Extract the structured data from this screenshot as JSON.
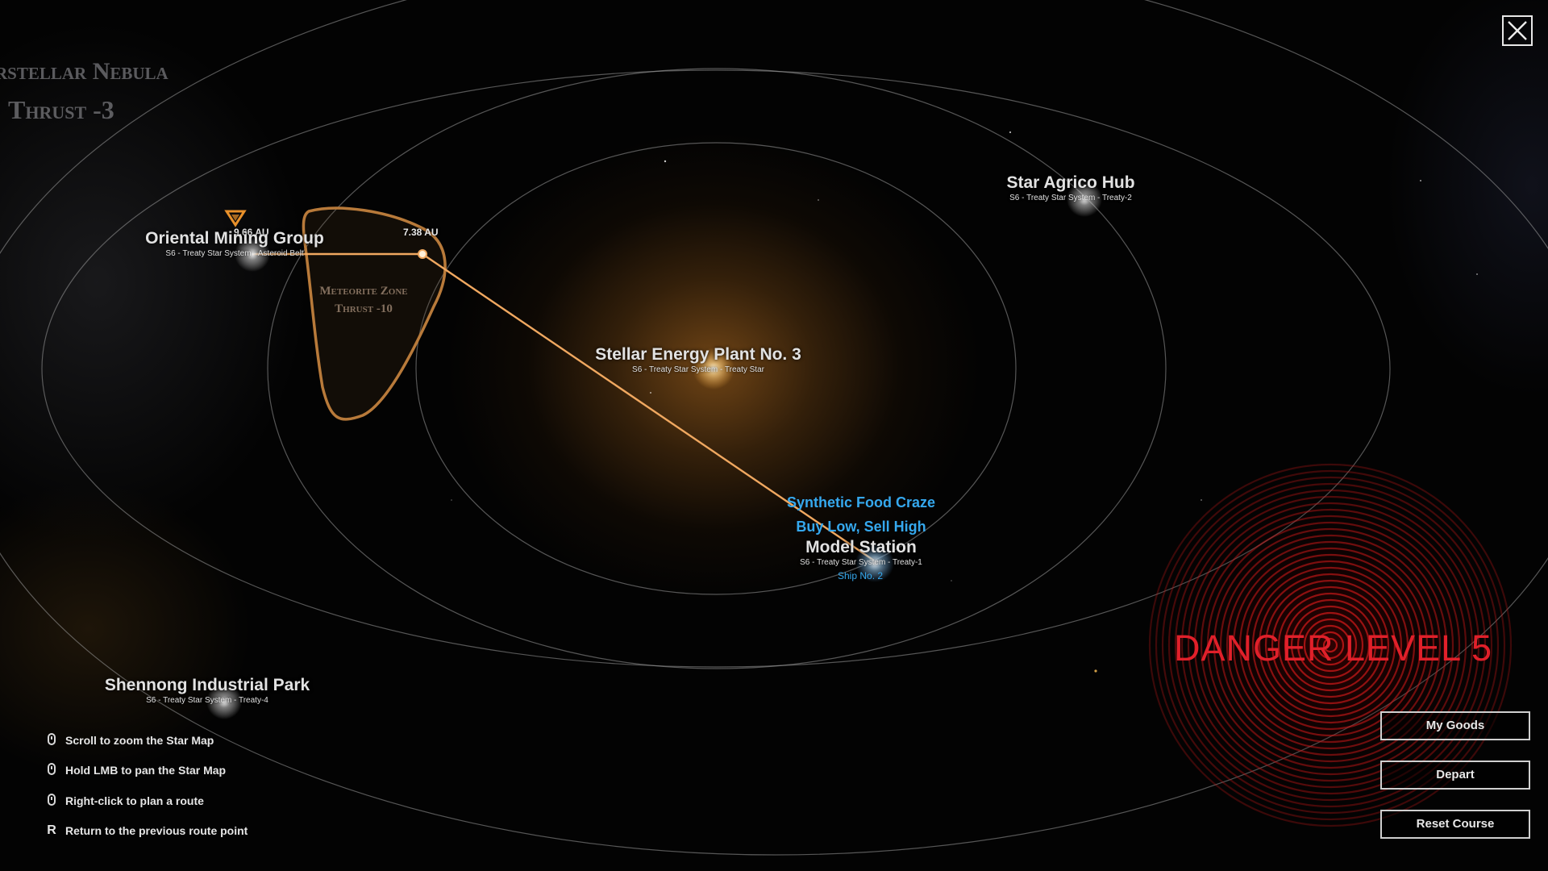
{
  "region": {
    "name": "rstellar Nebula",
    "effect": "Thrust -3"
  },
  "locations": {
    "oriental": {
      "name": "Oriental Mining Group",
      "sub": "S6 - Treaty Star System - Asteroid Belt"
    },
    "stellar": {
      "name": "Stellar Energy Plant No. 3",
      "sub": "S6 - Treaty Star System - Treaty Star"
    },
    "agrico": {
      "name": "Star Agrico Hub",
      "sub": "S6 - Treaty Star System - Treaty-2"
    },
    "model": {
      "name": "Model Station",
      "sub": "S6 - Treaty Star System - Treaty-1"
    },
    "shennong": {
      "name": "Shennong Industrial Park",
      "sub": "S6 - Treaty Star System - Treaty-4"
    }
  },
  "meteorite_zone": {
    "name": "Meteorite Zone",
    "effect": "Thrust -10"
  },
  "route": {
    "distance_1": "9.66 AU",
    "distance_2": "7.38 AU"
  },
  "events": {
    "line1": "Synthetic Food Craze",
    "line2": "Buy Low, Sell High"
  },
  "ship": {
    "label": "Ship No. 2"
  },
  "danger": {
    "label": "DANGER LEVEL 5"
  },
  "hints": [
    {
      "icon": "mouse-scroll-icon",
      "text": "Scroll to zoom the Star Map"
    },
    {
      "icon": "mouse-left-icon",
      "text": "Hold LMB to pan the Star Map"
    },
    {
      "icon": "mouse-right-icon",
      "text": "Right-click to plan a route"
    },
    {
      "icon": "key-r-icon",
      "key": "R",
      "text": "Return to the previous route point"
    }
  ],
  "buttons": {
    "my_goods": "My Goods",
    "depart": "Depart",
    "reset_course": "Reset Course"
  },
  "colors": {
    "route": "#f0a860",
    "meteor_border": "#b87a3a",
    "event_text": "#35a8ee",
    "danger": "#e0202a"
  }
}
